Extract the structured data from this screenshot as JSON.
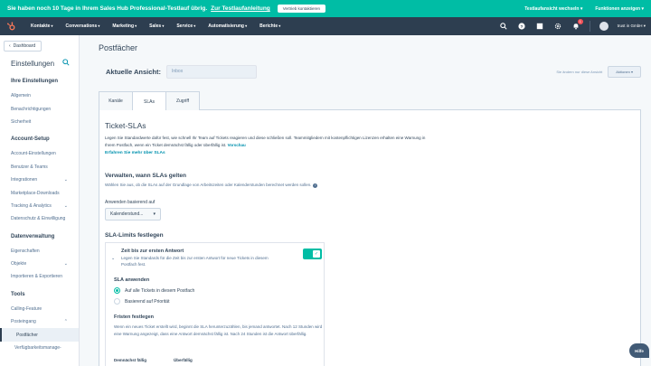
{
  "trial": {
    "message": "Sie haben noch 10 Tage in Ihrem Sales Hub Professional-Testlauf übrig.",
    "guide_link": "Zur Testlaufanleitung",
    "contact_button": "Vertrieb kontaktieren",
    "switch_trial": "Testlaufansicht wechseln",
    "show_features": "Funktionen anzeigen"
  },
  "nav": {
    "items": [
      "Kontakte",
      "Conversations",
      "Marketing",
      "Sales",
      "Service",
      "Automatisierung",
      "Berichte"
    ],
    "user": "trust in GmbH",
    "notification_count": "1"
  },
  "sidebar": {
    "dashboard": "Dashboard",
    "title": "Einstellungen",
    "sections": [
      {
        "label": "Ihre Einstellungen",
        "items": [
          "Allgemein",
          "Benachrichtigungen",
          "Sicherheit"
        ]
      },
      {
        "label": "Account-Setup",
        "items": [
          "Account-Einstellungen",
          "Benutzer & Teams",
          "Integrationen",
          "Marketplace-Downloads",
          "Tracking & Analytics",
          "Datenschutz & Einwilligung"
        ]
      },
      {
        "label": "Datenverwaltung",
        "items": [
          "Eigenschaften",
          "Objekte",
          "Importieren & Exportieren"
        ]
      },
      {
        "label": "Tools",
        "items": [
          "Calling-Feature",
          "Posteingang",
          "Postfächer",
          "Verfügbarkeitsmanage-"
        ]
      }
    ]
  },
  "main": {
    "page_title": "Postfächer",
    "current_view_label": "Aktuelle Ansicht:",
    "current_view_value": "Inbox",
    "view_hint": "Sie ändern nur diese Ansicht",
    "actions_button": "Aktionen",
    "tabs": [
      "Kanäle",
      "SLAs",
      "Zugriff"
    ],
    "active_tab": "SLAs"
  },
  "sla": {
    "title": "Ticket-SLAs",
    "description": "Legen Sie Standardwerte dafür fest, wie schnell Ihr Team auf Tickets reagieren und diese schließen soll. Teammitgliedern mit kostenpflichtigen Lizenzen erhalten eine Warnung in Ihrem Postfach, wenn ein Ticket demnächst fällig oder überfällig ist.",
    "preview_tag": "Vorschau",
    "learn_more": "Erfahren Sie mehr über SLAs",
    "manage_heading": "Verwalten, wann SLAs gelten",
    "manage_desc": "Wählen Sie aus, ob die SLAs auf der Grundlage von Arbeitszeiten oder Kalenderstunden berechnet werden sollen.",
    "apply_label": "Anwenden basierend auf",
    "apply_value": "Kalenderstund...",
    "limits_heading": "SLA-Limits festlegen",
    "first_response": {
      "title": "Zeit bis zur ersten Antwort",
      "description": "Legen Sie Standards für die Zeit bis zur ersten Antwort für neue Tickets in diesem Postfach fest.",
      "enabled": true,
      "apply_heading": "SLA anwenden",
      "options": [
        "Auf alle Tickets in diesem Postfach",
        "Basierend auf Priorität"
      ],
      "selected_option": 0,
      "deadlines_heading": "Fristen festlegen",
      "deadlines_desc": "Wenn ein neues Ticket erstellt wird, beginnt die SLA herunterzuzählen, bis jemand antwortet. Nach 12 Stunden wird eine Warnung angezeigt, dass eine Antwort demnächst fällig ist. Nach 24 Stunden ist die Antwort überfällig.",
      "col_due_soon": "Demnächst fällig",
      "col_overdue": "Überfällig"
    }
  },
  "help_button": "Hilfe"
}
